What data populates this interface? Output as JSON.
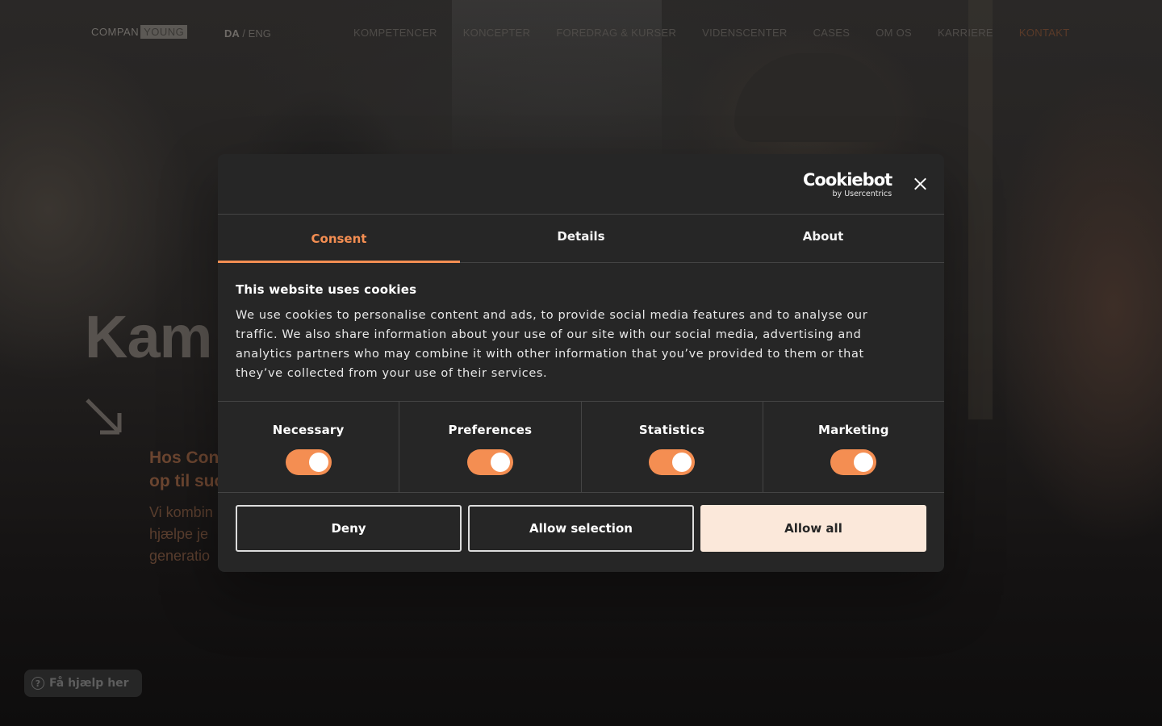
{
  "site": {
    "logo_left": "COMPAN",
    "logo_right": "YOUNG",
    "lang_da": "DA",
    "lang_sep": "/",
    "lang_en": "ENG",
    "nav": [
      "KOMPETENCER",
      "KONCEPTER",
      "FOREDRAG & KURSER",
      "VIDENSCENTER",
      "CASES",
      "OM OS",
      "KARRIERE"
    ],
    "nav_cta": "KONTAKT",
    "hero_title": "Kam",
    "hero_sub_1": "Hos Con",
    "hero_sub_2": "op til suc",
    "hero_body_1": "Vi kombin",
    "hero_body_2": "hjælpe je",
    "hero_body_3": "generatio",
    "help_label": "Få hjælp her",
    "help_icon": "question-icon"
  },
  "cookie_dialog": {
    "brand_name": "Cookiebot",
    "brand_by": "by Usercentrics",
    "close_icon": "close-icon",
    "tabs": [
      "Consent",
      "Details",
      "About"
    ],
    "active_tab": "Consent",
    "heading": "This website uses cookies",
    "body": "We use cookies to personalise content and ads, to provide social media features and to analyse our traffic. We also share information about your use of our site with our social media, advertising and analytics partners who may combine it with other information that you’ve provided to them or that they’ve collected from your use of their services.",
    "levels": [
      {
        "label": "Necessary",
        "enabled": true
      },
      {
        "label": "Preferences",
        "enabled": true
      },
      {
        "label": "Statistics",
        "enabled": true
      },
      {
        "label": "Marketing",
        "enabled": true
      }
    ],
    "buttons": {
      "deny": "Deny",
      "allow_selection": "Allow selection",
      "allow_all": "Allow all"
    },
    "accent_color": "#f48e52"
  }
}
